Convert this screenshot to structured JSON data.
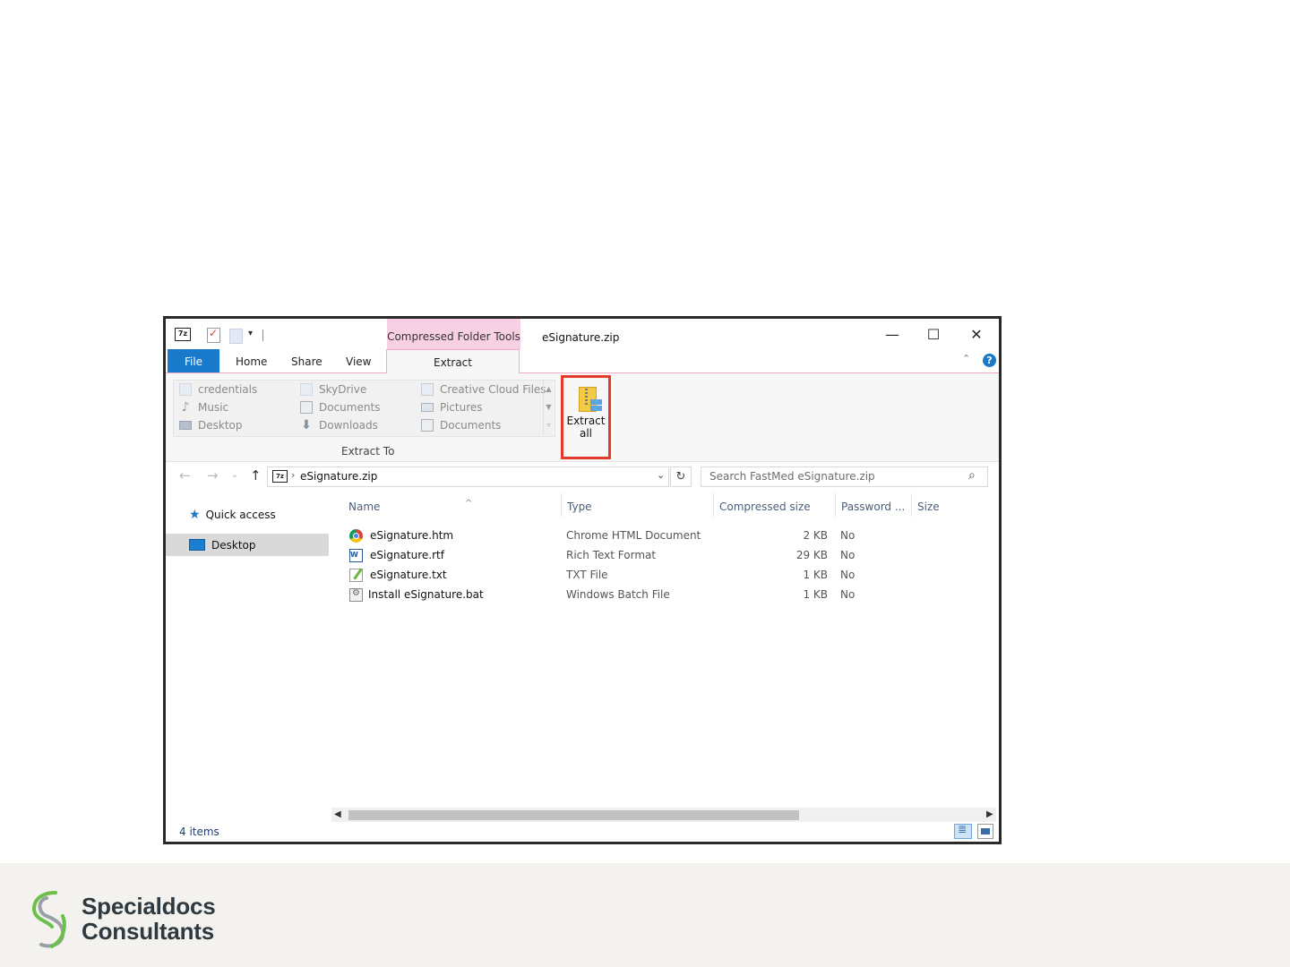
{
  "window": {
    "title": "eSignature.zip",
    "context_tab": "Compressed Folder Tools",
    "qat_7z_label": "7z",
    "minimize": "—",
    "maximize": "☐",
    "close": "✕"
  },
  "ribbon": {
    "tabs": [
      "File",
      "Home",
      "Share",
      "View",
      "Extract"
    ],
    "active_tab": "Extract",
    "help": "?",
    "extract_to": {
      "group_label": "Extract To",
      "columns": [
        [
          "credentials",
          "Music",
          "Desktop"
        ],
        [
          "SkyDrive",
          "Documents",
          "Downloads"
        ],
        [
          "Creative Cloud Files",
          "Pictures",
          "Documents"
        ]
      ]
    },
    "extract_all_label": "Extract\nall"
  },
  "address": {
    "path": "eSignature.zip",
    "icon_label": "7z",
    "search_placeholder": "Search FastMed eSignature.zip"
  },
  "nav_pane": {
    "items": [
      {
        "label": "Quick access",
        "icon": "star-icon",
        "selected": false
      },
      {
        "label": "Desktop",
        "icon": "desktop-icon",
        "selected": true
      }
    ]
  },
  "file_list": {
    "columns": [
      "Name",
      "Type",
      "Compressed size",
      "Password ...",
      "Size"
    ],
    "rows": [
      {
        "name": "eSignature.htm",
        "type": "Chrome HTML Document",
        "compressed_size": "2 KB",
        "password": "No",
        "icon": "chrome-icon"
      },
      {
        "name": "eSignature.rtf",
        "type": "Rich Text Format",
        "compressed_size": "29 KB",
        "password": "No",
        "icon": "word-icon"
      },
      {
        "name": "eSignature.txt",
        "type": "TXT File",
        "compressed_size": "1 KB",
        "password": "No",
        "icon": "text-file-icon"
      },
      {
        "name": "Install eSignature.bat",
        "type": "Windows Batch File",
        "compressed_size": "1 KB",
        "password": "No",
        "icon": "batch-file-icon"
      }
    ]
  },
  "status": {
    "item_count": "4 items"
  },
  "brand": {
    "line1": "Specialdocs",
    "line2": "Consultants"
  },
  "colors": {
    "accent_blue": "#1979ca",
    "context_pink": "#f8d0e4",
    "highlight_red": "#e33a2b",
    "brand_green": "#6cc04a"
  }
}
